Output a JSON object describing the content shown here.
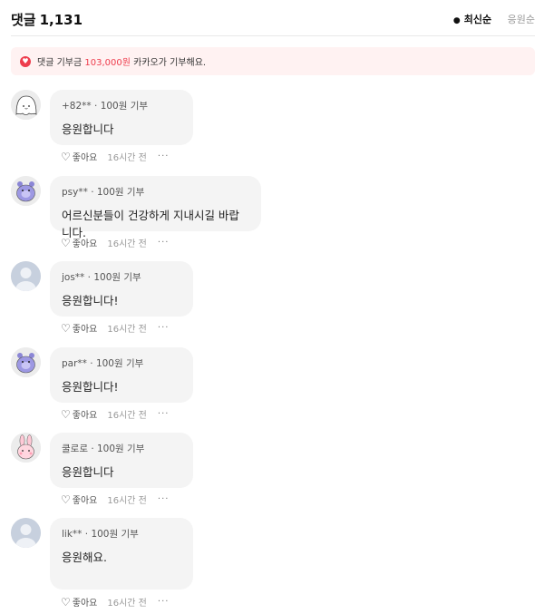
{
  "header": {
    "title": "댓글",
    "count": "1,131",
    "sort_latest": "최신순",
    "sort_cheer": "응원순"
  },
  "banner": {
    "prefix": "댓글 기부금",
    "amount": "103,000원",
    "suffix": "카카오가 기부해요."
  },
  "colors": {
    "accent": "#ee3d4d",
    "bubble_bg": "#f4f4f4",
    "banner_bg": "#fff2f2"
  },
  "comments": [
    {
      "user": "+82**",
      "donation": "100원 기부",
      "text": "응원합니다",
      "like": "좋아요",
      "time": "16시간 전",
      "more": "···",
      "avatar": "white-ghost-character"
    },
    {
      "user": "psy**",
      "donation": "100원 기부",
      "text": "어르신분들이 건강하게 지내시길 바랍니다.",
      "like": "좋아요",
      "time": "16시간 전",
      "more": "···",
      "avatar": "purple-monster-character"
    },
    {
      "user": "jos**",
      "donation": "100원 기부",
      "text": "응원합니다!",
      "like": "좋아요",
      "time": "16시간 전",
      "more": "···",
      "avatar": "default-person"
    },
    {
      "user": "par**",
      "donation": "100원 기부",
      "text": "응원합니다!",
      "like": "좋아요",
      "time": "16시간 전",
      "more": "···",
      "avatar": "purple-monster-character"
    },
    {
      "user": "쿨로로",
      "donation": "100원 기부",
      "text": "응원합니다",
      "like": "좋아요",
      "time": "16시간 전",
      "more": "···",
      "avatar": "pink-rabbit-character"
    },
    {
      "user": "lik**",
      "donation": "100원 기부",
      "text": "응원해요.",
      "like": "좋아요",
      "time": "16시간 전",
      "more": "···",
      "avatar": "default-person"
    }
  ]
}
